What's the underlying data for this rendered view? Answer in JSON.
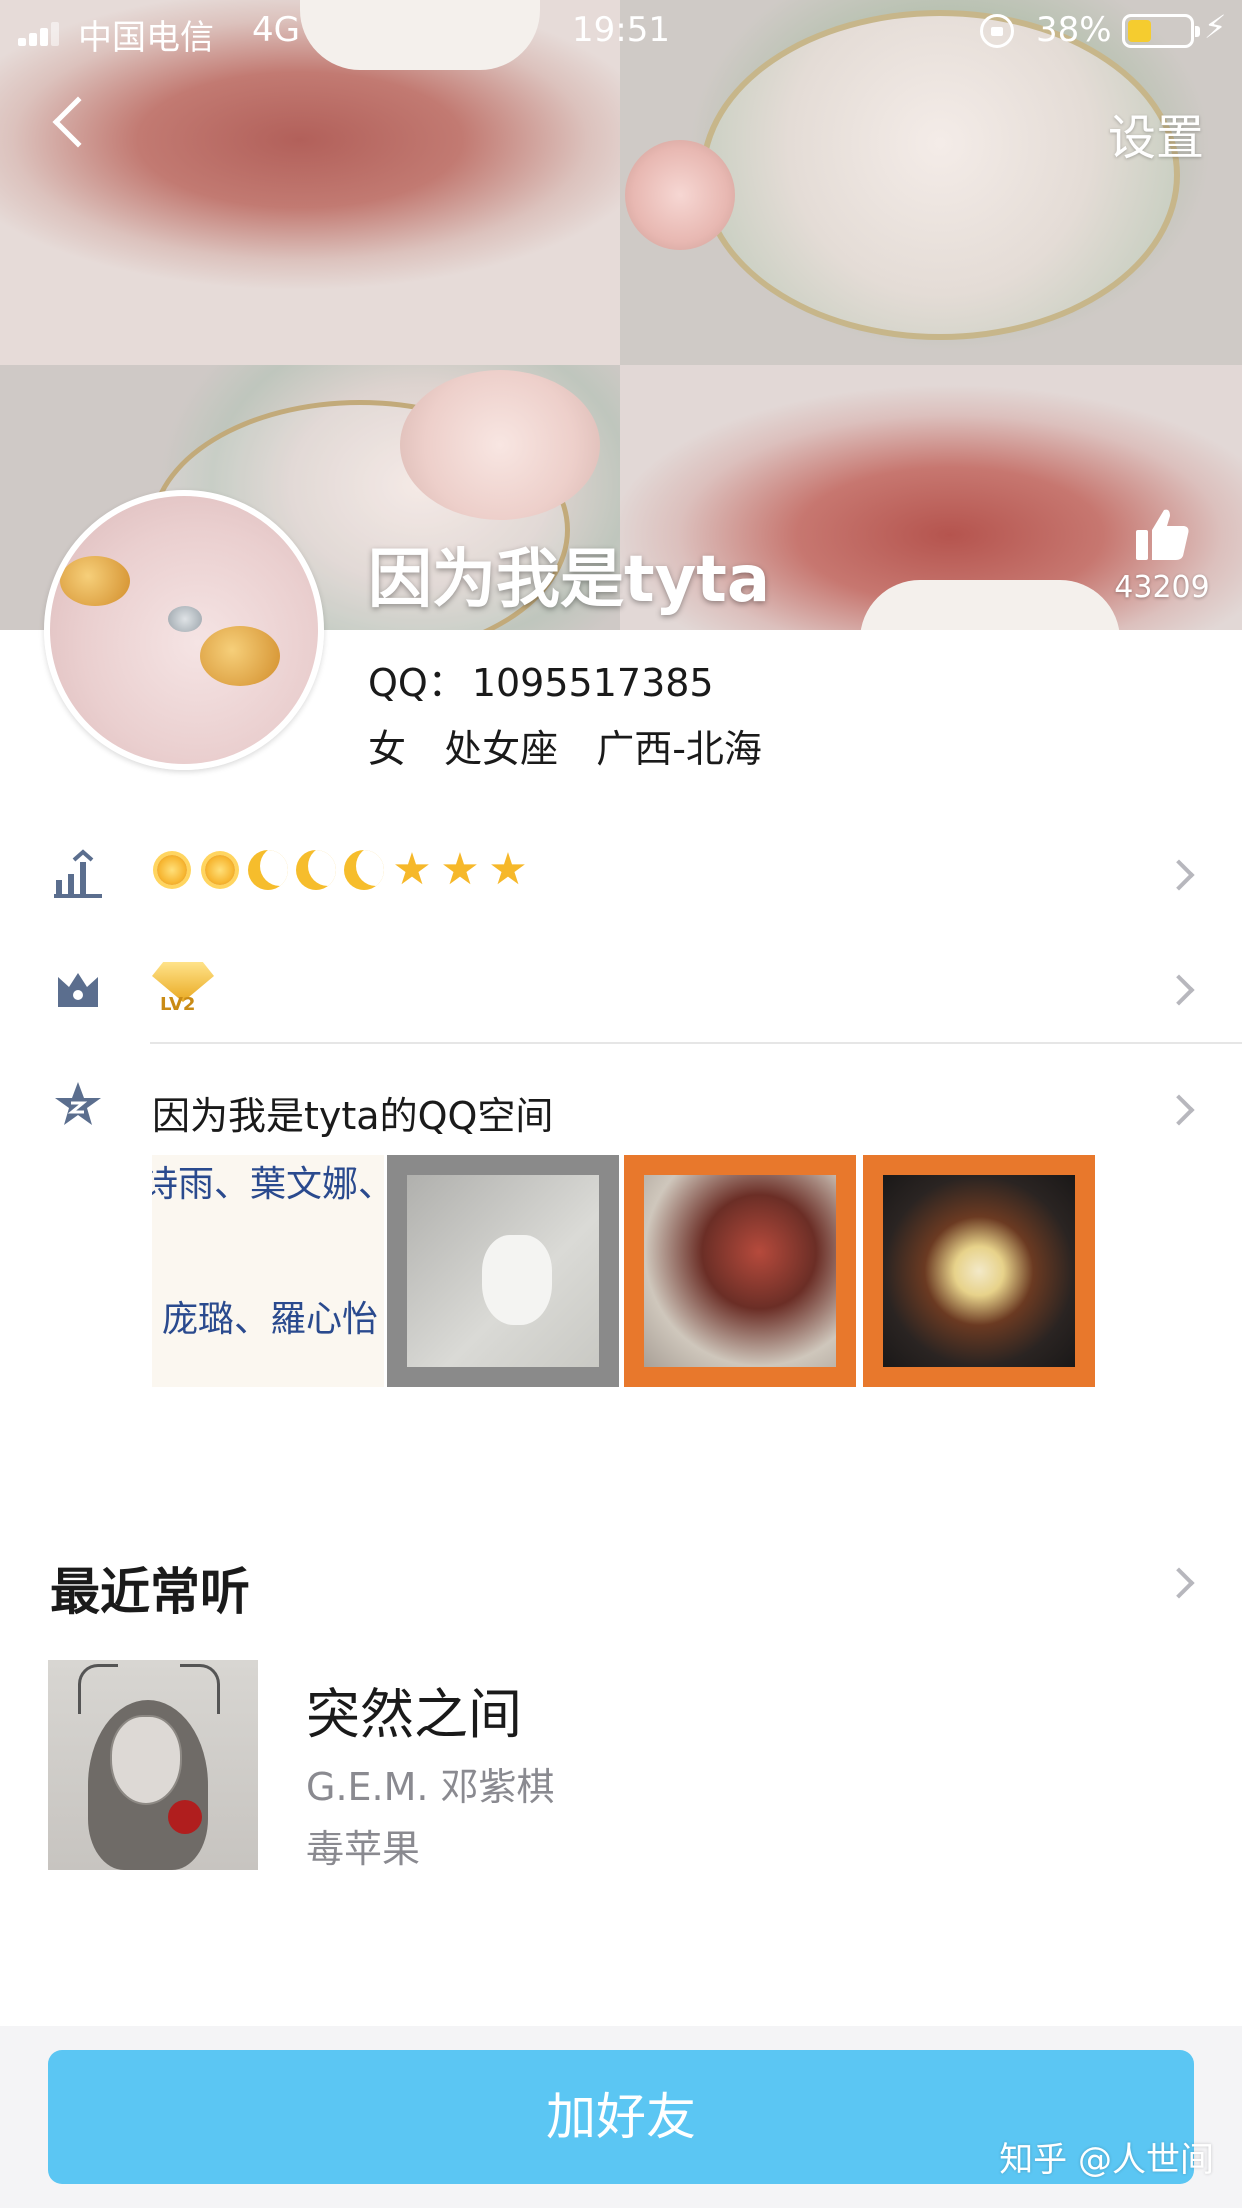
{
  "status_bar": {
    "carrier": "中国电信",
    "network": "4G",
    "time": "19:51",
    "battery_percent": "38%",
    "battery_level": 0.38
  },
  "nav": {
    "settings_label": "设置"
  },
  "profile": {
    "nickname": "因为我是tyta",
    "like_count": "43209",
    "qq_label": "QQ：",
    "qq_number": "1095517385",
    "gender": "女",
    "zodiac": "处女座",
    "location": "广西-北海"
  },
  "level_badges": [
    "sun",
    "sun",
    "moon",
    "moon",
    "moon",
    "star",
    "star",
    "star"
  ],
  "vip": {
    "level_text": "LV2"
  },
  "qzone": {
    "title": "因为我是tyta的QQ空间",
    "thumb1_line1": "诗雨、葉文娜、",
    "thumb1_line2": "庞璐、羅心怡"
  },
  "music": {
    "section_title": "最近常听",
    "song_title": "突然之间",
    "artist": "G.E.M. 邓紫棋",
    "album": "毒苹果"
  },
  "actions": {
    "add_friend_label": "加好友"
  },
  "watermark": "知乎 @人世间",
  "colors": {
    "primary_button": "#5bc6f3",
    "badge_gold": "#f6b82a",
    "chevron": "#b7b7bd"
  }
}
